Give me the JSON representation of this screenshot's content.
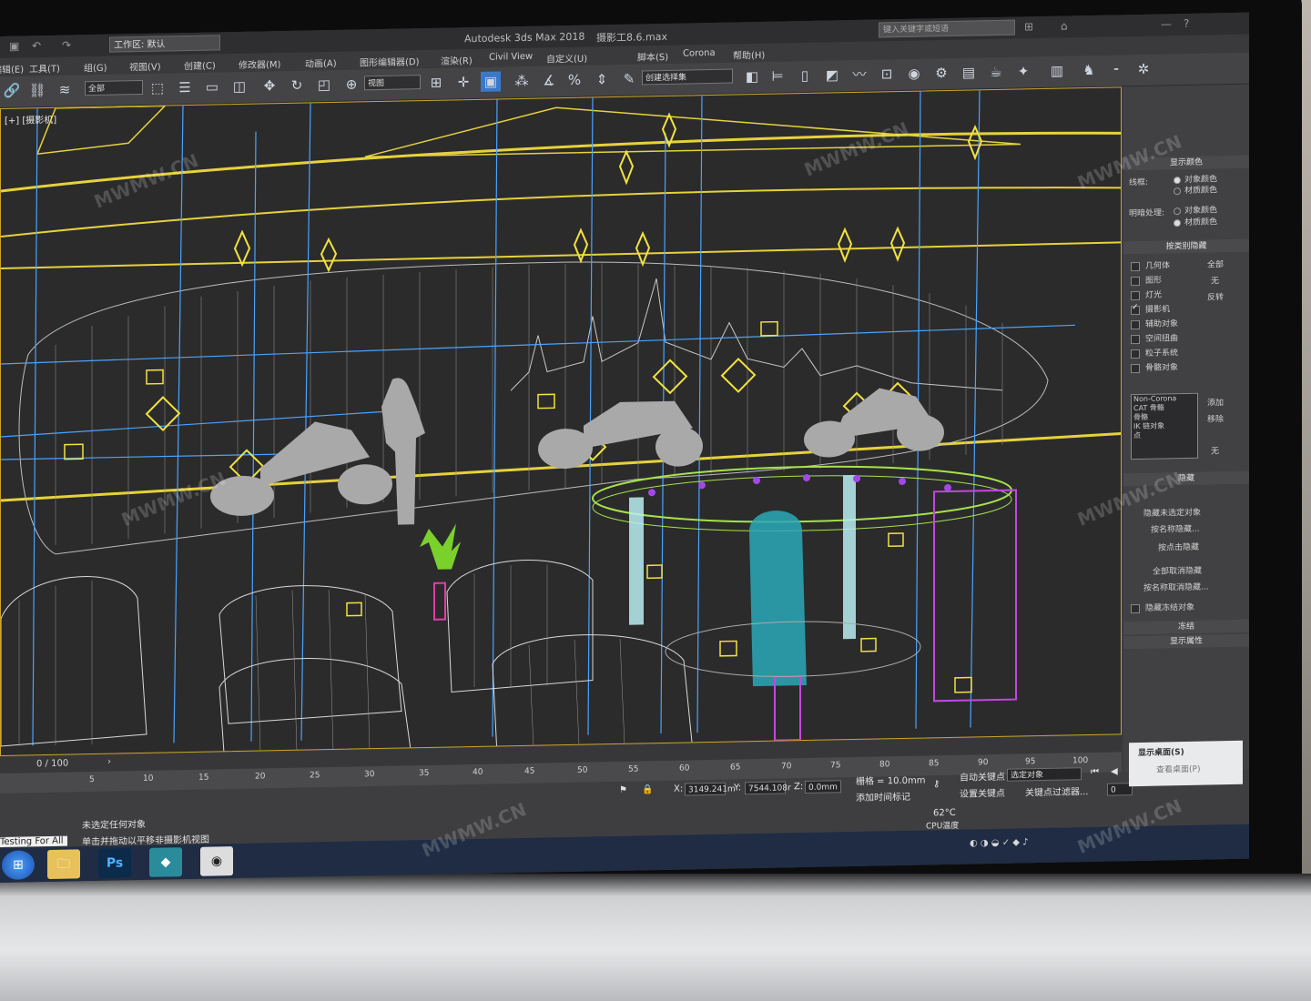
{
  "title_bar": {
    "app_title": "Autodesk 3ds Max 2018",
    "file_name": "摄影工8.6.max",
    "workspace": "工作区: 默认",
    "search_placeholder": "键入关键字或短语"
  },
  "menu": [
    "编辑(E)",
    "工具(T)",
    "组(G)",
    "视图(V)",
    "创建(C)",
    "修改器(M)",
    "动画(A)",
    "图形编辑器(D)",
    "渲染(R)",
    "Civil View",
    "自定义(U)",
    "脚本(S)",
    "Corona",
    "帮助(H)"
  ],
  "toolbar": {
    "selection_filter": "全部",
    "reference_coord": "视图",
    "named_selection": "创建选择集"
  },
  "viewport": {
    "label": "[+] [摄影机]",
    "shaded_mode": "线框"
  },
  "command_panel": {
    "display_color_header": "显示颜色",
    "wireframe_label": "线框:",
    "shaded_label": "明暗处理:",
    "object_color": "对象颜色",
    "material_color": "材质颜色",
    "hide_by_category_header": "按类别隐藏",
    "categories": [
      "几何体",
      "图形",
      "灯光",
      "摄影机",
      "辅助对象",
      "空间扭曲",
      "粒子系统",
      "骨骼对象"
    ],
    "categories_checked": [
      false,
      false,
      false,
      true,
      false,
      false,
      false,
      false
    ],
    "cat_buttons": [
      "全部",
      "无",
      "反转"
    ],
    "filter_list": [
      "Non-Corona",
      "CAT 骨骼",
      "骨骼",
      "IK 链对象",
      "点"
    ],
    "filter_buttons": [
      "添加",
      "移除",
      "无"
    ],
    "hide_header": "隐藏",
    "hide_buttons": [
      "隐藏未选定对象",
      "按名称隐藏...",
      "按点击隐藏",
      "全部取消隐藏",
      "按名称取消隐藏...",
      "隐藏冻结对象"
    ],
    "freeze_header": "冻结",
    "display_props_header": "显示属性"
  },
  "timeline": {
    "frame_counter": "0 / 100",
    "ticks": [
      "5",
      "10",
      "15",
      "20",
      "25",
      "30",
      "35",
      "40",
      "45",
      "50",
      "55",
      "60",
      "65",
      "70",
      "75",
      "80",
      "85",
      "90",
      "95",
      "100"
    ]
  },
  "status": {
    "selection_msg": "未选定任何对象",
    "prompt_msg": "单击并拖动以平移非摄影机视图",
    "maxscript": "Testing For All",
    "x_label": "X:",
    "x_value": "3149.241m",
    "y_label": "Y:",
    "y_value": "7544.108r",
    "z_label": "Z:",
    "z_value": "0.0mm",
    "grid": "栅格 = 10.0mm",
    "add_time_tag": "添加时间标记",
    "auto_key": "自动关键点",
    "set_key": "设置关键点",
    "selected_obj": "选定对象",
    "key_filters": "关键点过滤器...",
    "frame_field": "0",
    "cpu_temp": "62°C",
    "cpu_label": "CPU温度"
  },
  "tray_popup": {
    "show_desktop": "显示桌面(S)",
    "view_desktop": "查看桌面(P)"
  },
  "taskbar": [
    "start",
    "explorer",
    "Ps",
    "3dsmax",
    "camera"
  ],
  "watermarks": [
    "MWMW.CN",
    "MWMW.CN",
    "MWMW.CN",
    "MWMW.CN",
    "MWMW.CN",
    "MWMW.CN",
    "MWMW.CN"
  ]
}
